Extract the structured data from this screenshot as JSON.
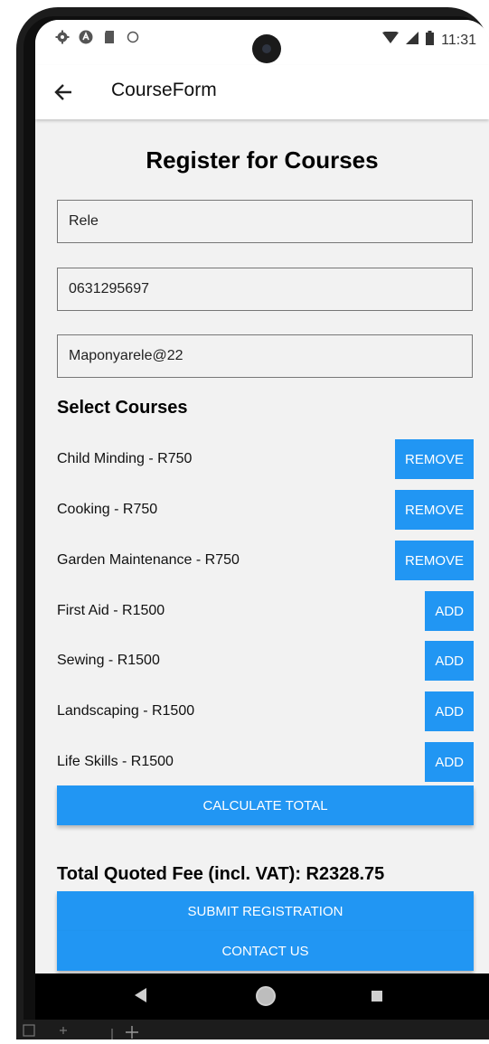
{
  "status_bar": {
    "time": "11:31",
    "icons_left": [
      "gear-icon",
      "a-icon",
      "sd-card-icon",
      "dot-icon"
    ],
    "icons_right": [
      "wifi-icon",
      "signal-icon",
      "battery-icon"
    ]
  },
  "app_bar": {
    "title": "CourseForm",
    "back_icon": "back-arrow-icon"
  },
  "form": {
    "title": "Register for Courses",
    "name_value": "Rele",
    "phone_value": "0631295697",
    "email_value": "Maponyarele@22"
  },
  "courses": {
    "heading": "Select Courses",
    "items": [
      {
        "label": "Child Minding - R750",
        "action": "REMOVE"
      },
      {
        "label": "Cooking - R750",
        "action": "REMOVE"
      },
      {
        "label": "Garden Maintenance - R750",
        "action": "REMOVE"
      },
      {
        "label": "First Aid - R1500",
        "action": "ADD"
      },
      {
        "label": "Sewing - R1500",
        "action": "ADD"
      },
      {
        "label": "Landscaping - R1500",
        "action": "ADD"
      },
      {
        "label": "Life Skills - R1500",
        "action": "ADD"
      }
    ]
  },
  "actions": {
    "calculate_label": "CALCULATE TOTAL",
    "total_text": "Total Quoted Fee (incl. VAT): R2328.75",
    "submit_label": "SUBMIT REGISTRATION",
    "contact_label": "CONTACT US"
  },
  "nav_bar": {
    "icons": [
      "nav-back-icon",
      "nav-home-icon",
      "nav-recents-icon"
    ]
  },
  "colors": {
    "accent": "#2196f3",
    "background": "#f2f2f2",
    "app_bar": "#ffffff",
    "nav_bar": "#000000"
  }
}
